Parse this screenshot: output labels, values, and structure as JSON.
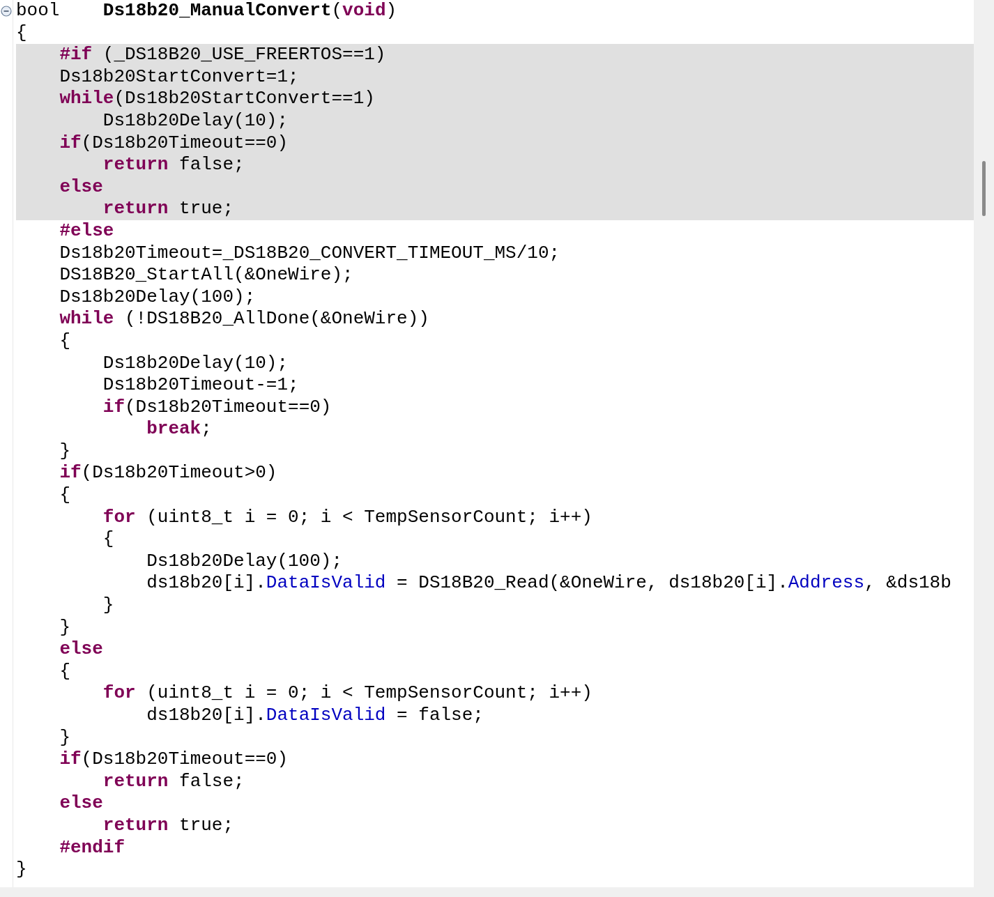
{
  "editor": {
    "lines": [
      {
        "highlighted": false,
        "tokens": [
          {
            "kind": "plain",
            "text": "bool    "
          },
          {
            "kind": "func",
            "text": "Ds18b20_ManualConvert"
          },
          {
            "kind": "plain",
            "text": "("
          },
          {
            "kind": "keyword",
            "text": "void"
          },
          {
            "kind": "plain",
            "text": ")"
          }
        ]
      },
      {
        "highlighted": false,
        "tokens": [
          {
            "kind": "plain",
            "text": "{"
          }
        ],
        "children": [
          {
            "highlighted": true,
            "tokens": [
              {
                "kind": "keyword",
                "text": "#if"
              },
              {
                "kind": "plain",
                "text": " (_DS18B20_USE_FREERTOS==1)"
              }
            ]
          },
          {
            "highlighted": true,
            "tokens": [
              {
                "kind": "plain",
                "text": "Ds18b20StartConvert=1;"
              }
            ]
          },
          {
            "highlighted": true,
            "tokens": [
              {
                "kind": "keyword",
                "text": "while"
              },
              {
                "kind": "plain",
                "text": "(Ds18b20StartConvert==1)"
              }
            ],
            "children": [
              {
                "highlighted": true,
                "tokens": [
                  {
                    "kind": "plain",
                    "text": "Ds18b20Delay(10);"
                  }
                ]
              }
            ]
          },
          {
            "highlighted": true,
            "tokens": [
              {
                "kind": "keyword",
                "text": "if"
              },
              {
                "kind": "plain",
                "text": "(Ds18b20Timeout==0)"
              }
            ],
            "children": [
              {
                "highlighted": true,
                "tokens": [
                  {
                    "kind": "keyword",
                    "text": "return"
                  },
                  {
                    "kind": "plain",
                    "text": " false;"
                  }
                ]
              }
            ]
          },
          {
            "highlighted": true,
            "tokens": [
              {
                "kind": "keyword",
                "text": "else"
              }
            ],
            "children": [
              {
                "highlighted": true,
                "tokens": [
                  {
                    "kind": "keyword",
                    "text": "return"
                  },
                  {
                    "kind": "plain",
                    "text": " true;"
                  }
                ]
              }
            ]
          },
          {
            "highlighted": false,
            "tokens": [
              {
                "kind": "keyword",
                "text": "#else"
              }
            ]
          },
          {
            "highlighted": false,
            "tokens": [
              {
                "kind": "plain",
                "text": "Ds18b20Timeout=_DS18B20_CONVERT_TIMEOUT_MS/10;"
              }
            ]
          },
          {
            "highlighted": false,
            "tokens": [
              {
                "kind": "plain",
                "text": "DS18B20_StartAll(&OneWire);"
              }
            ]
          },
          {
            "highlighted": false,
            "tokens": [
              {
                "kind": "plain",
                "text": "Ds18b20Delay(100);"
              }
            ]
          },
          {
            "highlighted": false,
            "tokens": [
              {
                "kind": "keyword",
                "text": "while"
              },
              {
                "kind": "plain",
                "text": " (!DS18B20_AllDone(&OneWire))"
              }
            ]
          },
          {
            "highlighted": false,
            "tokens": [
              {
                "kind": "plain",
                "text": "{"
              }
            ],
            "children": [
              {
                "highlighted": false,
                "tokens": [
                  {
                    "kind": "plain",
                    "text": "Ds18b20Delay(10);"
                  }
                ]
              },
              {
                "highlighted": false,
                "tokens": [
                  {
                    "kind": "plain",
                    "text": "Ds18b20Timeout-=1;"
                  }
                ]
              },
              {
                "highlighted": false,
                "tokens": [
                  {
                    "kind": "keyword",
                    "text": "if"
                  },
                  {
                    "kind": "plain",
                    "text": "(Ds18b20Timeout==0)"
                  }
                ],
                "children": [
                  {
                    "highlighted": false,
                    "tokens": [
                      {
                        "kind": "keyword",
                        "text": "break"
                      },
                      {
                        "kind": "plain",
                        "text": ";"
                      }
                    ]
                  }
                ]
              }
            ]
          },
          {
            "highlighted": false,
            "tokens": [
              {
                "kind": "plain",
                "text": "}"
              }
            ]
          },
          {
            "highlighted": false,
            "tokens": [
              {
                "kind": "keyword",
                "text": "if"
              },
              {
                "kind": "plain",
                "text": "(Ds18b20Timeout>0)"
              }
            ]
          },
          {
            "highlighted": false,
            "tokens": [
              {
                "kind": "plain",
                "text": "{"
              }
            ],
            "children": [
              {
                "highlighted": false,
                "tokens": [
                  {
                    "kind": "keyword",
                    "text": "for"
                  },
                  {
                    "kind": "plain",
                    "text": " (uint8_t i = 0; i < TempSensorCount; i++)"
                  }
                ]
              },
              {
                "highlighted": false,
                "tokens": [
                  {
                    "kind": "plain",
                    "text": "{"
                  }
                ],
                "children": [
                  {
                    "highlighted": false,
                    "tokens": [
                      {
                        "kind": "plain",
                        "text": "Ds18b20Delay(100);"
                      }
                    ]
                  },
                  {
                    "highlighted": false,
                    "tokens": [
                      {
                        "kind": "plain",
                        "text": "ds18b20[i]."
                      },
                      {
                        "kind": "field",
                        "text": "DataIsValid"
                      },
                      {
                        "kind": "plain",
                        "text": " = DS18B20_Read(&OneWire, ds18b20[i]."
                      },
                      {
                        "kind": "field",
                        "text": "Address"
                      },
                      {
                        "kind": "plain",
                        "text": ", &ds18b"
                      }
                    ]
                  }
                ]
              },
              {
                "highlighted": false,
                "tokens": [
                  {
                    "kind": "plain",
                    "text": "}"
                  }
                ]
              }
            ]
          },
          {
            "highlighted": false,
            "tokens": [
              {
                "kind": "plain",
                "text": "}"
              }
            ]
          },
          {
            "highlighted": false,
            "tokens": [
              {
                "kind": "keyword",
                "text": "else"
              }
            ]
          },
          {
            "highlighted": false,
            "tokens": [
              {
                "kind": "plain",
                "text": "{"
              }
            ],
            "children": [
              {
                "highlighted": false,
                "tokens": [
                  {
                    "kind": "keyword",
                    "text": "for"
                  },
                  {
                    "kind": "plain",
                    "text": " (uint8_t i = 0; i < TempSensorCount; i++)"
                  }
                ],
                "children": [
                  {
                    "highlighted": false,
                    "tokens": [
                      {
                        "kind": "plain",
                        "text": "ds18b20[i]."
                      },
                      {
                        "kind": "field",
                        "text": "DataIsValid"
                      },
                      {
                        "kind": "plain",
                        "text": " = false;"
                      }
                    ]
                  }
                ]
              }
            ]
          },
          {
            "highlighted": false,
            "tokens": [
              {
                "kind": "plain",
                "text": "}"
              }
            ]
          },
          {
            "highlighted": false,
            "tokens": [
              {
                "kind": "keyword",
                "text": "if"
              },
              {
                "kind": "plain",
                "text": "(Ds18b20Timeout==0)"
              }
            ],
            "children": [
              {
                "highlighted": false,
                "tokens": [
                  {
                    "kind": "keyword",
                    "text": "return"
                  },
                  {
                    "kind": "plain",
                    "text": " false;"
                  }
                ]
              }
            ]
          },
          {
            "highlighted": false,
            "tokens": [
              {
                "kind": "keyword",
                "text": "else"
              }
            ],
            "children": [
              {
                "highlighted": false,
                "tokens": [
                  {
                    "kind": "keyword",
                    "text": "return"
                  },
                  {
                    "kind": "plain",
                    "text": " true;"
                  }
                ]
              }
            ]
          },
          {
            "highlighted": false,
            "tokens": [
              {
                "kind": "keyword",
                "text": "#endif"
              }
            ]
          }
        ]
      },
      {
        "highlighted": false,
        "tokens": [
          {
            "kind": "plain",
            "text": "}"
          }
        ]
      }
    ]
  }
}
